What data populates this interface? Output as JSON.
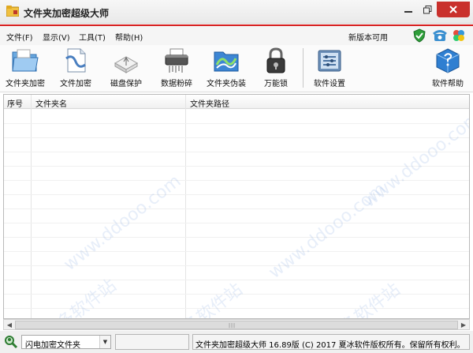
{
  "window": {
    "title": "文件夹加密超级大师"
  },
  "menu": {
    "items": [
      "文件(F)",
      "显示(V)",
      "工具(T)",
      "帮助(H)"
    ],
    "update_link": "新版本可用"
  },
  "toolbar": {
    "items": [
      {
        "label": "文件夹加密",
        "icon": "folder-encrypt-icon"
      },
      {
        "label": "文件加密",
        "icon": "file-encrypt-icon"
      },
      {
        "label": "磁盘保护",
        "icon": "usb-disk-icon"
      },
      {
        "label": "数据粉碎",
        "icon": "shredder-icon"
      },
      {
        "label": "文件夹伪装",
        "icon": "folder-disguise-icon"
      },
      {
        "label": "万能锁",
        "icon": "padlock-icon"
      },
      {
        "label": "软件设置",
        "icon": "settings-icon"
      },
      {
        "label": "软件帮助",
        "icon": "help-cube-icon"
      }
    ]
  },
  "list": {
    "columns": [
      "序号",
      "文件夹名",
      "文件夹路径"
    ],
    "rows": []
  },
  "status": {
    "mode_select": "闪电加密文件夹",
    "info_text": "文件夹加密超级大师 16.89版 (C) 2017  夏冰软件版权所有。保留所有权利。"
  },
  "watermark": "www.ddooo.com",
  "watermark_cn": "多多软件站",
  "colors": {
    "accent_red": "#d51b1b",
    "close_button": "#c9302c"
  }
}
